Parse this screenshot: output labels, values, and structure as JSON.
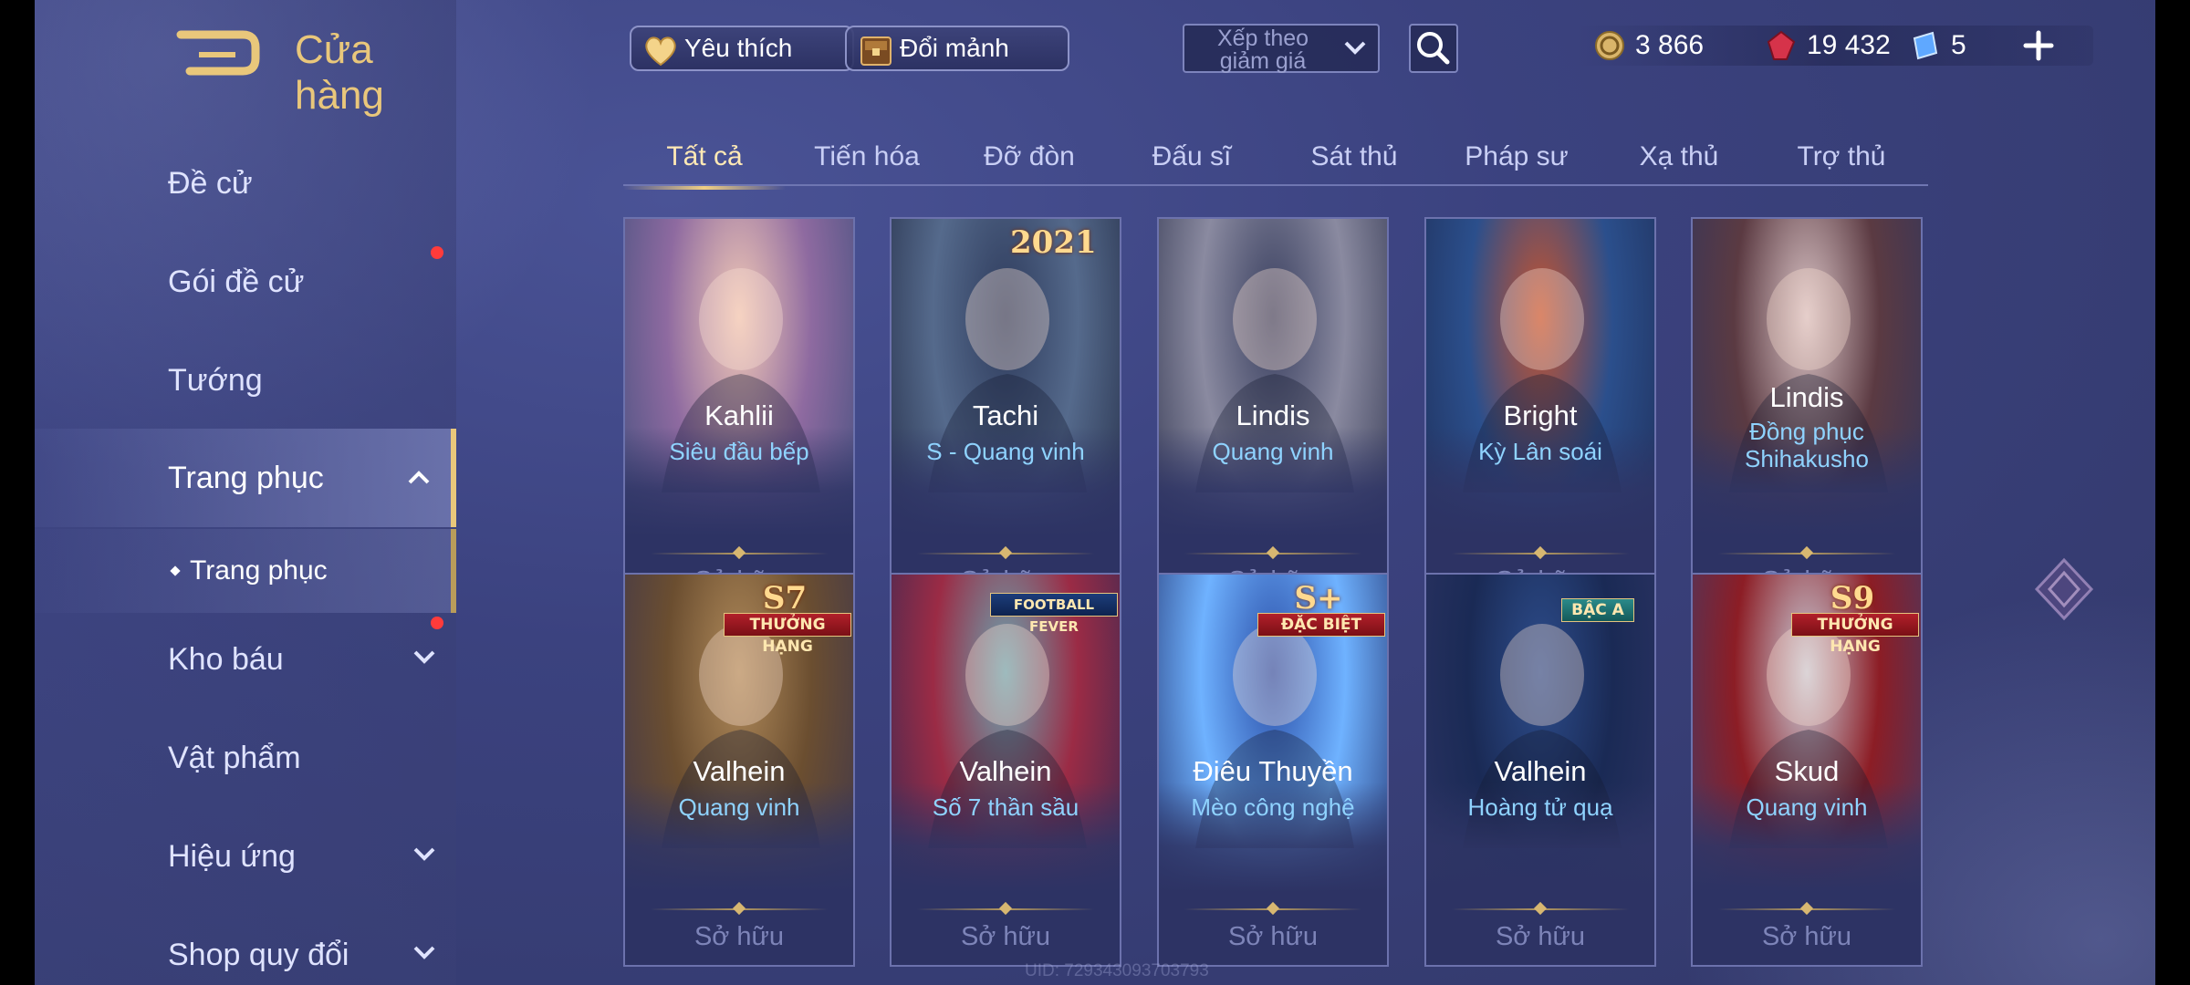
{
  "header": {
    "title": "Cửa hàng",
    "favorites_label": "Yêu thích",
    "exchange_label": "Đổi mảnh",
    "sort_label": "Xếp theo giảm giá",
    "currencies": [
      {
        "icon": "gold-coin-icon",
        "value": "3 866"
      },
      {
        "icon": "ruby-gem-icon",
        "value": "19 432"
      },
      {
        "icon": "voucher-icon",
        "value": "5"
      }
    ]
  },
  "sidebar": {
    "items": [
      {
        "label": "Đề cử"
      },
      {
        "label": "Gói đề cử"
      },
      {
        "label": "Tướng"
      },
      {
        "label": "Trang phục"
      },
      {
        "label": "Kho báu"
      },
      {
        "label": "Vật phẩm"
      },
      {
        "label": "Hiệu ứng"
      },
      {
        "label": "Shop quy đổi"
      }
    ],
    "sub_item": "Trang phục"
  },
  "tabs": [
    "Tất cả",
    "Tiến hóa",
    "Đỡ đòn",
    "Đấu sĩ",
    "Sát thủ",
    "Pháp sư",
    "Xạ thủ",
    "Trợ thủ"
  ],
  "active_tab": "Tất cả",
  "cards": [
    {
      "hero": "Kahlii",
      "skin": "Siêu đầu bếp",
      "status": "Sở hữu",
      "badge_top": "",
      "badge_ribbon": "",
      "colors": [
        "#f1c9b6",
        "#8e6aa0",
        "#3a4d7a"
      ]
    },
    {
      "hero": "Tachi",
      "skin": "S - Quang vinh",
      "status": "Sở hữu",
      "badge_top": "2021",
      "badge_ribbon": "",
      "colors": [
        "#2e3b5c",
        "#556a8c",
        "#1f2740"
      ]
    },
    {
      "hero": "Lindis",
      "skin": "Quang vinh",
      "status": "Sở hữu",
      "badge_top": "",
      "badge_ribbon": "",
      "colors": [
        "#3a4060",
        "#8a8aa0",
        "#2a2f4a"
      ]
    },
    {
      "hero": "Bright",
      "skin": "Kỳ Lân soái",
      "status": "Sở hữu",
      "badge_top": "",
      "badge_ribbon": "",
      "colors": [
        "#c7532e",
        "#2b4f8c",
        "#1e2c55"
      ]
    },
    {
      "hero": "Lindis",
      "skin": "Đồng phục Shihakusho",
      "status": "Sở hữu",
      "badge_top": "",
      "badge_ribbon": "",
      "colors": [
        "#d9c3c5",
        "#5b3a42",
        "#2e3560"
      ]
    },
    {
      "hero": "Valhein",
      "skin": "Quang vinh",
      "status": "Sở hữu",
      "badge_top": "S7",
      "badge_ribbon": "THƯỞNG HẠNG",
      "colors": [
        "#b08a5a",
        "#6b4e30",
        "#3a3450"
      ]
    },
    {
      "hero": "Valhein",
      "skin": "Số 7 thần sầu",
      "status": "Sở hữu",
      "badge_top": "",
      "badge_ribbon": "FOOTBALL FEVER",
      "colors": [
        "#6aa4b0",
        "#9b2b45",
        "#2e2a55"
      ]
    },
    {
      "hero": "Điêu Thuyền",
      "skin": "Mèo công nghệ",
      "status": "Sở hữu",
      "badge_top": "S+",
      "badge_ribbon": "ĐẶC BIỆT",
      "colors": [
        "#2b4fa8",
        "#6fb2ff",
        "#1c2a66"
      ]
    },
    {
      "hero": "Valhein",
      "skin": "Hoàng tử quạ",
      "status": "Sở hữu",
      "badge_top": "",
      "badge_ribbon": "BẬC A",
      "colors": [
        "#2d4d8c",
        "#1a2a55",
        "#2f3566"
      ]
    },
    {
      "hero": "Skud",
      "skin": "Quang vinh",
      "status": "Sở hữu",
      "badge_top": "S9",
      "badge_ribbon": "THƯỞNG HẠNG",
      "colors": [
        "#c9ccd8",
        "#8c1d25",
        "#3a3f70"
      ]
    }
  ],
  "footer": {
    "uid": "UID: 729343093703793"
  }
}
